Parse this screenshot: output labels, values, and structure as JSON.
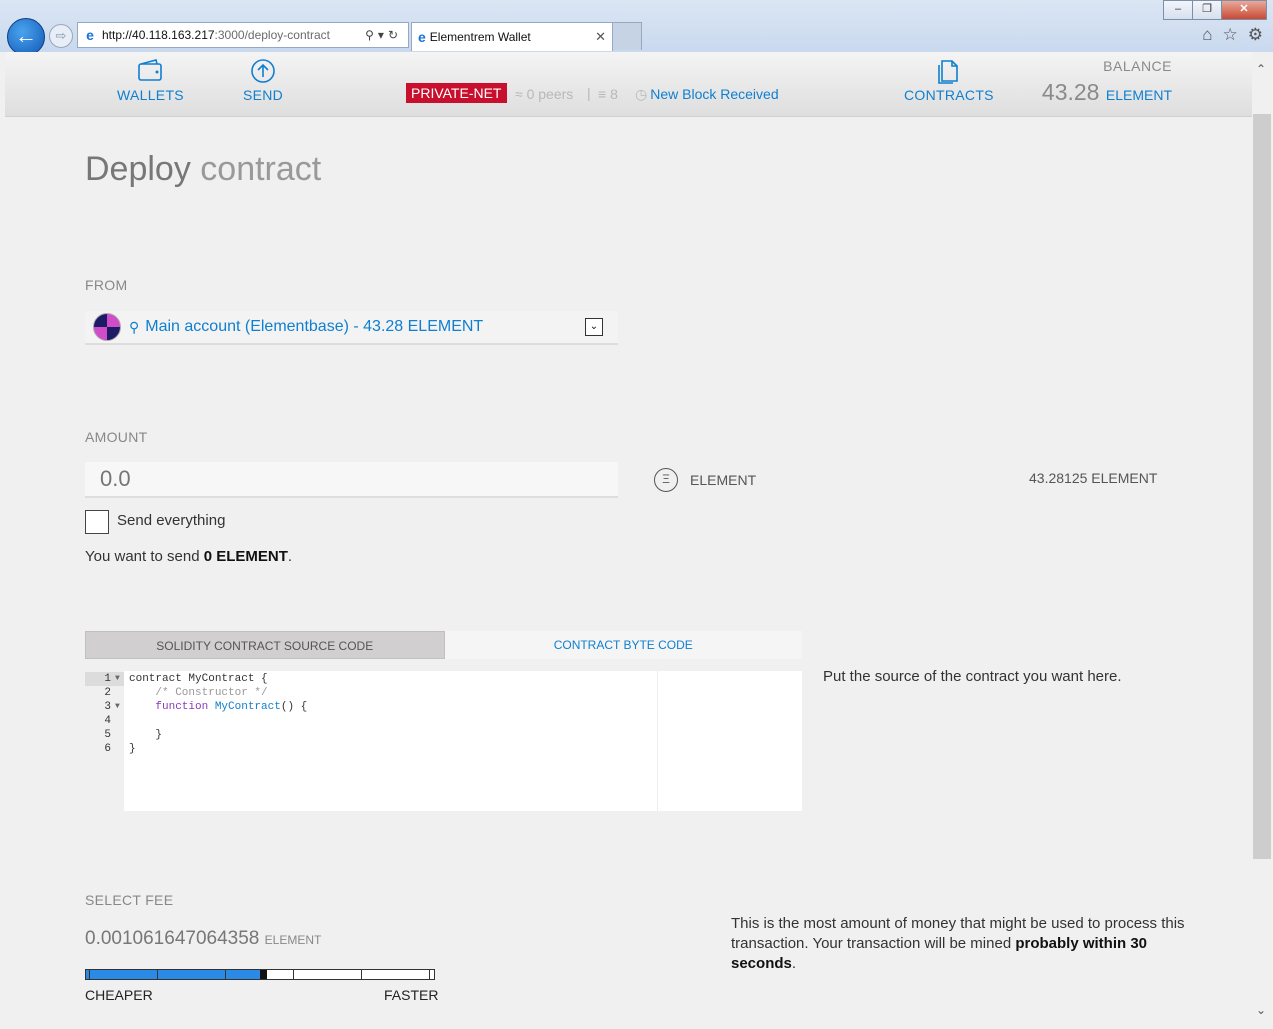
{
  "browser": {
    "url_host": "http://40.118.163.217",
    "url_path": ":3000/deploy-contract",
    "tab_title": "Elementrem Wallet"
  },
  "nav": {
    "wallets": "WALLETS",
    "send": "SEND",
    "contracts": "CONTRACTS",
    "network": "PRIVATE-NET",
    "peers": "0 peers",
    "separator": "|",
    "blocks": "8",
    "block_status": "New Block Received",
    "balance_label": "BALANCE",
    "balance_value": "43.28",
    "balance_unit": "ELEMENT"
  },
  "page": {
    "title_strong": "Deploy",
    "title_light": "contract"
  },
  "from": {
    "label": "FROM",
    "account": "Main account (Elementbase) - 43.28 ELEMENT"
  },
  "amount": {
    "label": "AMOUNT",
    "placeholder": "0.0",
    "unit": "ELEMENT",
    "unit_symbol": "Ξ",
    "max_balance": "43.28125 ELEMENT",
    "send_everything": "Send everything",
    "want_send_prefix": "You want to send ",
    "want_send_value": "0 ELEMENT",
    "want_send_suffix": "."
  },
  "code_tabs": {
    "source": "SOLIDITY CONTRACT SOURCE CODE",
    "bytecode": "CONTRACT BYTE CODE"
  },
  "editor": {
    "line_numbers": [
      "1",
      "2",
      "3",
      "4",
      "5",
      "6"
    ],
    "line1_kw": "contract ",
    "line1_rest": "MyContract {",
    "line2": "    /* Constructor */",
    "line3_kw": "    function ",
    "line3_fn": "MyContract",
    "line3_rest": "() {",
    "line4": "",
    "line5": "    }",
    "line6": "}"
  },
  "source_help": "Put the source of the contract you want here.",
  "fee": {
    "label": "SELECT FEE",
    "amount": "0.001061647064358",
    "unit": "ELEMENT",
    "cheaper": "CHEAPER",
    "faster": "FASTER",
    "slider_position": 0.5,
    "help_part1": "This is the most amount of money that might be used to process this transaction. Your transaction will be mined ",
    "help_bold": "probably within 30 seconds",
    "help_part2": "."
  },
  "colors": {
    "accent": "#0f7fcf",
    "network_badge": "#c8102e",
    "fee_fill": "#2a8ae6"
  }
}
